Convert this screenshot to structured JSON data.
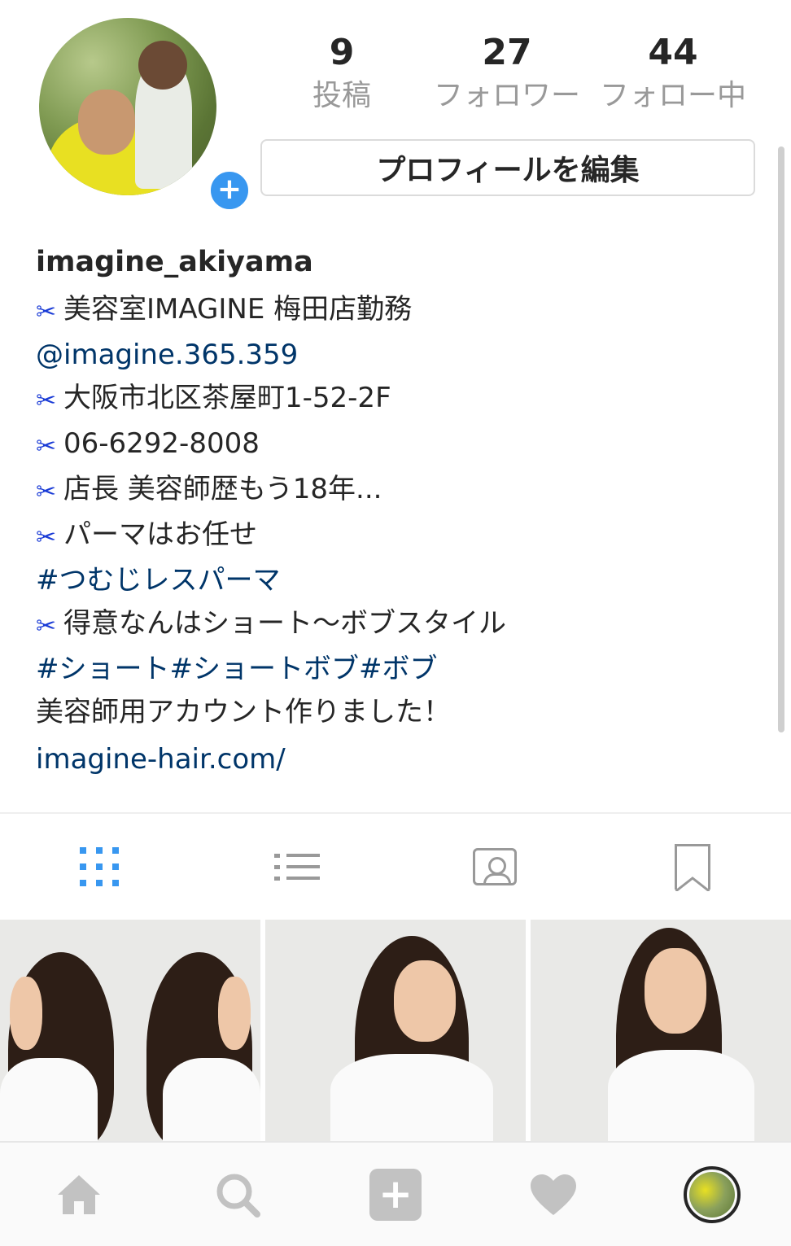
{
  "profile": {
    "username": "imagine_akiyama",
    "edit_button": "プロフィールを編集",
    "add_badge": "+"
  },
  "stats": [
    {
      "value": "9",
      "label": "投稿"
    },
    {
      "value": "27",
      "label": "フォロワー"
    },
    {
      "value": "44",
      "label": "フォロー中"
    }
  ],
  "bio": {
    "line1": "美容室IMAGINE 梅田店勤務",
    "line2": "@imagine.365.359",
    "line3": "大阪市北区茶屋町1-52-2F",
    "line4": "06-6292-8008",
    "line5": "店長 美容師歴もう18年...",
    "line6": "パーマはお任せ",
    "line7": "#つむじレスパーマ",
    "line8": "得意なんはショート～ボブスタイル",
    "line9": "#ショート#ショートボブ#ボブ",
    "line10": "美容師用アカウント作りました！",
    "website": "imagine-hair.com/"
  },
  "tabs": [
    "grid-icon",
    "list-icon",
    "tagged-icon",
    "bookmark-icon"
  ],
  "bottom_nav": [
    "home-icon",
    "search-icon",
    "add-post-icon",
    "heart-icon",
    "profile-avatar"
  ],
  "colors": {
    "accent": "#3897f0",
    "link": "#003569",
    "scissors": "#1a3bd6",
    "muted": "#999999"
  }
}
